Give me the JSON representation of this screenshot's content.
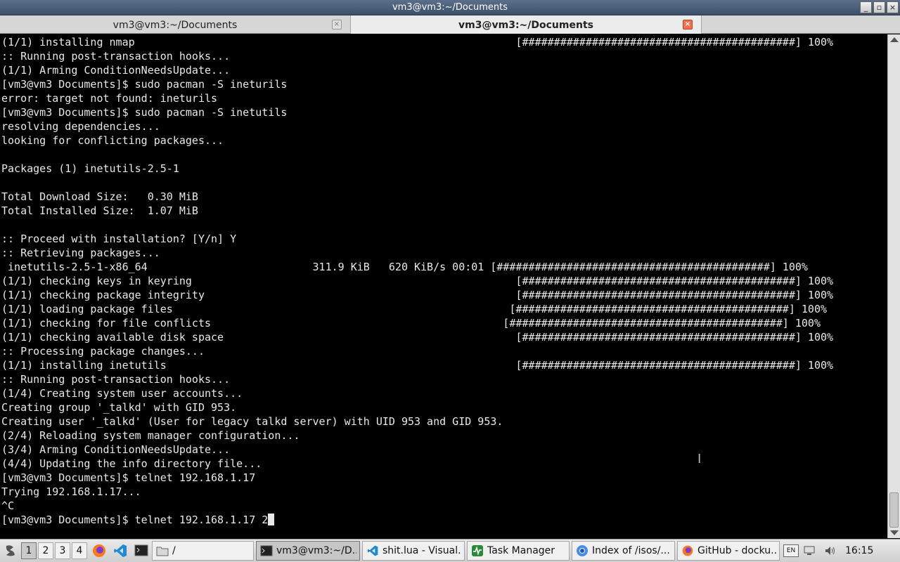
{
  "window": {
    "title": "vm3@vm3:~/Documents",
    "buttons": [
      "_",
      "▫",
      "×"
    ]
  },
  "tabs": [
    {
      "label": "vm3@vm3:~/Documents",
      "active": false
    },
    {
      "label": "vm3@vm3:~/Documents",
      "active": true
    }
  ],
  "terminal": {
    "lines": [
      "(1/1) installing nmap                                                            [###########################################] 100%",
      ":: Running post-transaction hooks...",
      "(1/1) Arming ConditionNeedsUpdate...",
      "[vm3@vm3 Documents]$ sudo pacman -S ineturils",
      "error: target not found: ineturils",
      "[vm3@vm3 Documents]$ sudo pacman -S inetutils",
      "resolving dependencies...",
      "looking for conflicting packages...",
      "",
      "Packages (1) inetutils-2.5-1",
      "",
      "Total Download Size:   0.30 MiB",
      "Total Installed Size:  1.07 MiB",
      "",
      ":: Proceed with installation? [Y/n] Y",
      ":: Retrieving packages...",
      " inetutils-2.5-1-x86_64                          311.9 KiB   620 KiB/s 00:01 [###########################################] 100%",
      "(1/1) checking keys in keyring                                                   [###########################################] 100%",
      "(1/1) checking package integrity                                                 [###########################################] 100%",
      "(1/1) loading package files                                                     [###########################################] 100%",
      "(1/1) checking for file conflicts                                              [###########################################] 100%",
      "(1/1) checking available disk space                                              [###########################################] 100%",
      ":: Processing package changes...",
      "(1/1) installing inetutils                                                       [###########################################] 100%",
      ":: Running post-transaction hooks...",
      "(1/4) Creating system user accounts...",
      "Creating group '_talkd' with GID 953.",
      "Creating user '_talkd' (User for legacy talkd server) with UID 953 and GID 953.",
      "(2/4) Reloading system manager configuration...",
      "(3/4) Arming ConditionNeedsUpdate...",
      "(4/4) Updating the info directory file...",
      "[vm3@vm3 Documents]$ telnet 192.168.1.17",
      "Trying 192.168.1.17...",
      "^C"
    ],
    "prompt_line": "[vm3@vm3 Documents]$ telnet 192.168.1.17 2"
  },
  "taskbar": {
    "desktops": [
      "1",
      "2",
      "3",
      "4"
    ],
    "active_desktop": "1",
    "launchers": [
      "menu-icon",
      "firefox-icon",
      "vscode-icon",
      "terminal-icon"
    ],
    "tasks": [
      {
        "label": "/",
        "icon": "folder-icon",
        "active": false
      },
      {
        "label": "vm3@vm3:~/D...",
        "icon": "terminal-icon",
        "active": true
      },
      {
        "label": "shit.lua - Visual...",
        "icon": "vscode-icon",
        "active": false
      },
      {
        "label": "Task Manager",
        "icon": "task-manager-icon",
        "active": false
      },
      {
        "label": "Index of /isos/...",
        "icon": "chromium-icon",
        "active": false
      },
      {
        "label": "GitHub - docku...",
        "icon": "firefox-icon",
        "active": false
      }
    ],
    "tray": {
      "keyboard": "EN",
      "clock": "16:15"
    }
  }
}
